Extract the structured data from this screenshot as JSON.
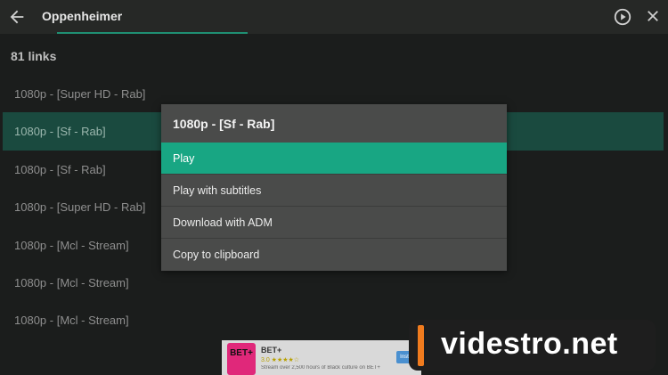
{
  "header": {
    "title": "Oppenheimer"
  },
  "links_count": "81 links",
  "links": [
    {
      "label": "1080p  - [Super HD - Rab]"
    },
    {
      "label": "1080p  - [Sf - Rab]"
    },
    {
      "label": "1080p  - [Sf - Rab]"
    },
    {
      "label": "1080p  - [Super HD - Rab]"
    },
    {
      "label": "1080p  - [Mcl - Stream]"
    },
    {
      "label": "1080p  - [Mcl - Stream]"
    },
    {
      "label": "1080p  - [Mcl - Stream]"
    }
  ],
  "menu": {
    "title": "1080p  - [Sf - Rab]",
    "items": [
      {
        "label": "Play"
      },
      {
        "label": "Play with subtitles"
      },
      {
        "label": "Download with ADM"
      },
      {
        "label": "Copy to clipboard"
      }
    ]
  },
  "ad": {
    "icon_text": "BET+",
    "name": "BET+",
    "rating": "3.0 ★★★★☆",
    "desc": "Stream over 2,500 hours of Black culture on BET+",
    "button": "Install"
  },
  "watermark": {
    "text": "videstro.net",
    "accent": "#f07b1e"
  },
  "colors": {
    "accent": "#18a683",
    "selected_row": "#1a4a3f",
    "background": "#1b1d1c"
  }
}
